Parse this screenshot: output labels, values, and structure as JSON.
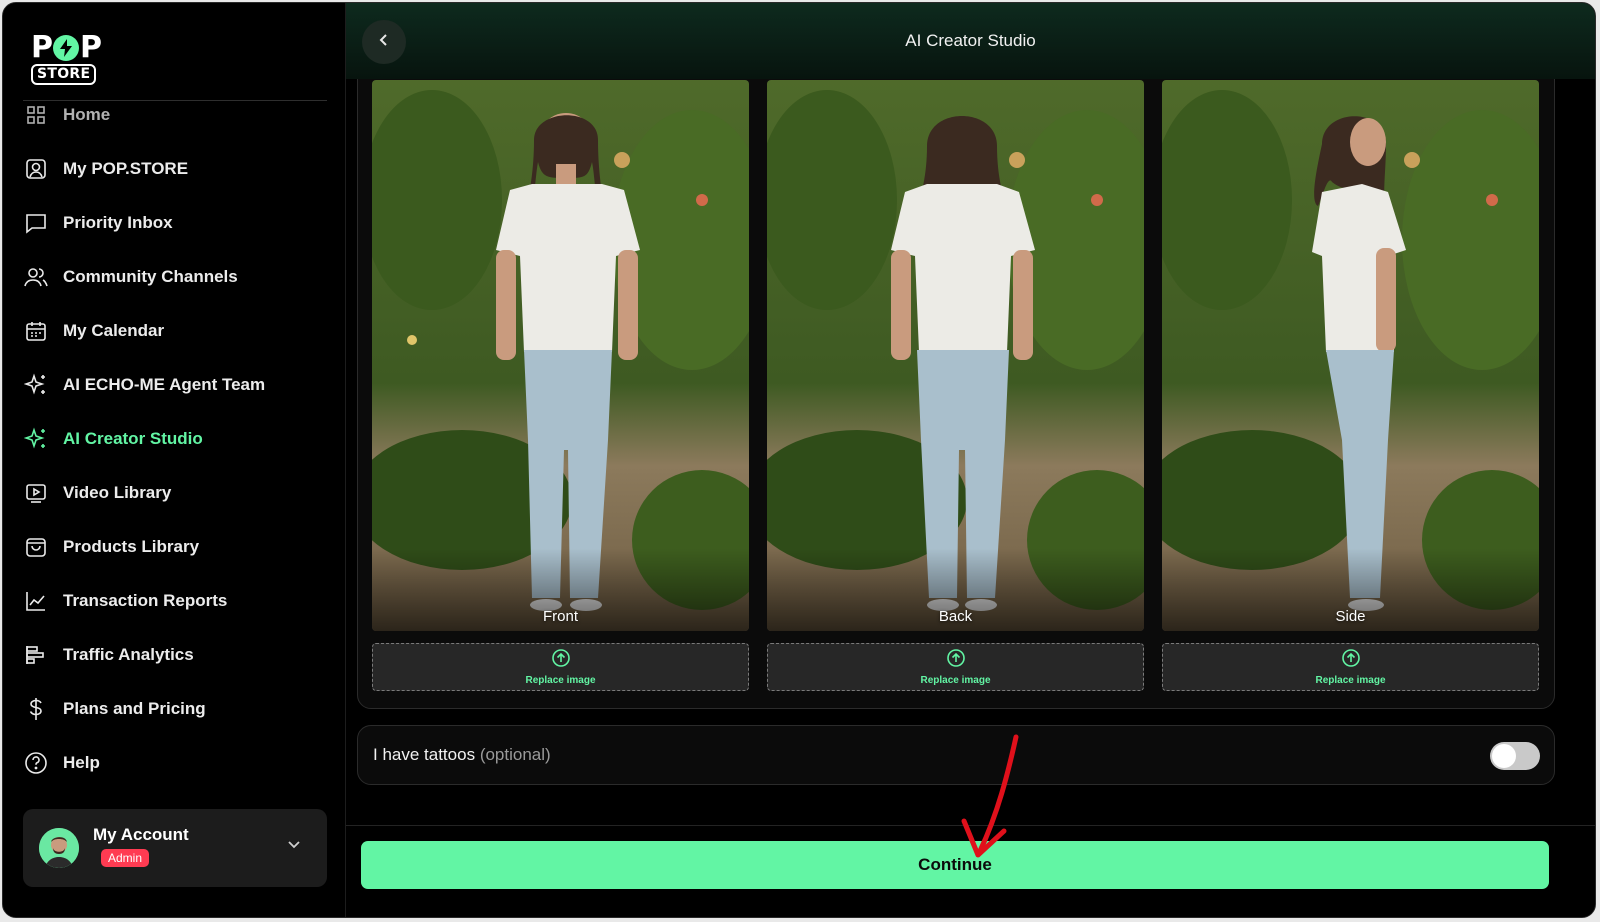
{
  "logo": {
    "top_text_left": "P",
    "top_text_right": "P",
    "bottom_text": "STORE"
  },
  "sidebar": {
    "items": [
      {
        "label": "Home",
        "icon": "home-icon"
      },
      {
        "label": "My POP.STORE",
        "icon": "user-square-icon"
      },
      {
        "label": "Priority Inbox",
        "icon": "message-icon"
      },
      {
        "label": "Community Channels",
        "icon": "users-icon"
      },
      {
        "label": "My Calendar",
        "icon": "calendar-icon"
      },
      {
        "label": "AI ECHO-ME Agent Team",
        "icon": "sparkles-icon"
      },
      {
        "label": "AI Creator Studio",
        "icon": "sparkles-icon",
        "active": true
      },
      {
        "label": "Video Library",
        "icon": "video-icon"
      },
      {
        "label": "Products Library",
        "icon": "shopping-bag-icon"
      },
      {
        "label": "Transaction Reports",
        "icon": "chart-line-icon"
      },
      {
        "label": "Traffic Analytics",
        "icon": "bar-chart-icon"
      },
      {
        "label": "Plans and Pricing",
        "icon": "dollar-icon"
      },
      {
        "label": "Help",
        "icon": "help-circle-icon"
      }
    ],
    "account": {
      "name": "My Account",
      "role": "Admin"
    }
  },
  "header": {
    "title": "AI Creator Studio"
  },
  "photos": [
    {
      "label": "Front",
      "replace_label": "Replace image"
    },
    {
      "label": "Back",
      "replace_label": "Replace image"
    },
    {
      "label": "Side",
      "replace_label": "Replace image"
    }
  ],
  "tattoos": {
    "label": "I have tattoos",
    "optional": "(optional)",
    "enabled": false
  },
  "footer": {
    "continue_label": "Continue"
  },
  "colors": {
    "accent": "#62f5a4",
    "badge": "#ff3b52",
    "annotation_arrow": "#e0101b"
  }
}
